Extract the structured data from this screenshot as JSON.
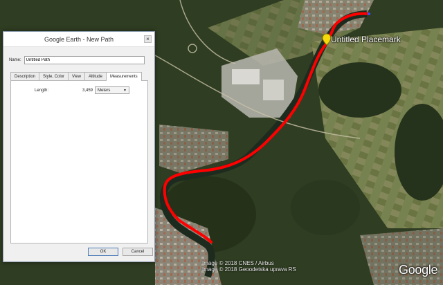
{
  "app": {
    "window_title": "Google Earth - New Path"
  },
  "dialog": {
    "close_glyph": "×",
    "name_label": "Name:",
    "name_value": "Untitled Path",
    "tabs": [
      {
        "label": "Description"
      },
      {
        "label": "Style, Color"
      },
      {
        "label": "View"
      },
      {
        "label": "Altitude"
      },
      {
        "label": "Measurements",
        "active": true
      }
    ],
    "measurements": {
      "length_label": "Length:",
      "length_value": "3,459",
      "unit_selected": "Meters"
    },
    "ok_label": "OK",
    "cancel_label": "Cancel"
  },
  "map": {
    "placemark_label": "Untitled Placemark",
    "path_color": "#ff0000",
    "copyright_lines": [
      "Image © 2018 CNES / Airbus",
      "Image © 2018 Geoodetska uprava RS"
    ],
    "logo_text": "Google"
  }
}
